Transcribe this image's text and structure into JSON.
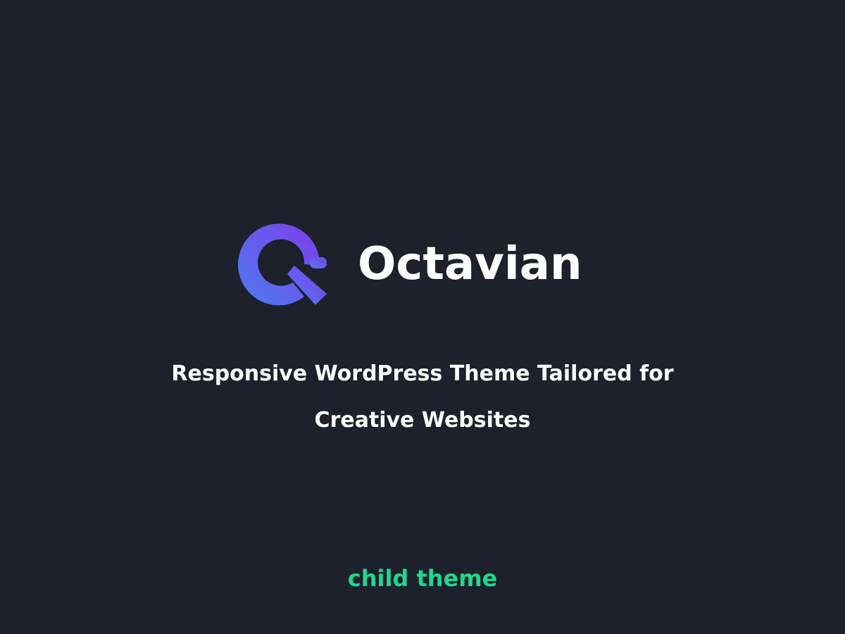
{
  "brand": {
    "name": "Octavian",
    "logo_icon": "octavian-q-logo-icon",
    "gradient_start": "#4f7bf1",
    "gradient_end": "#7d3ee8"
  },
  "tagline": {
    "line1": "Responsive WordPress Theme Tailored for",
    "line2": "Creative Websites"
  },
  "badge": {
    "label": "child theme",
    "color": "#1fd790"
  },
  "colors": {
    "background": "#1c212b",
    "text": "#ffffff"
  }
}
